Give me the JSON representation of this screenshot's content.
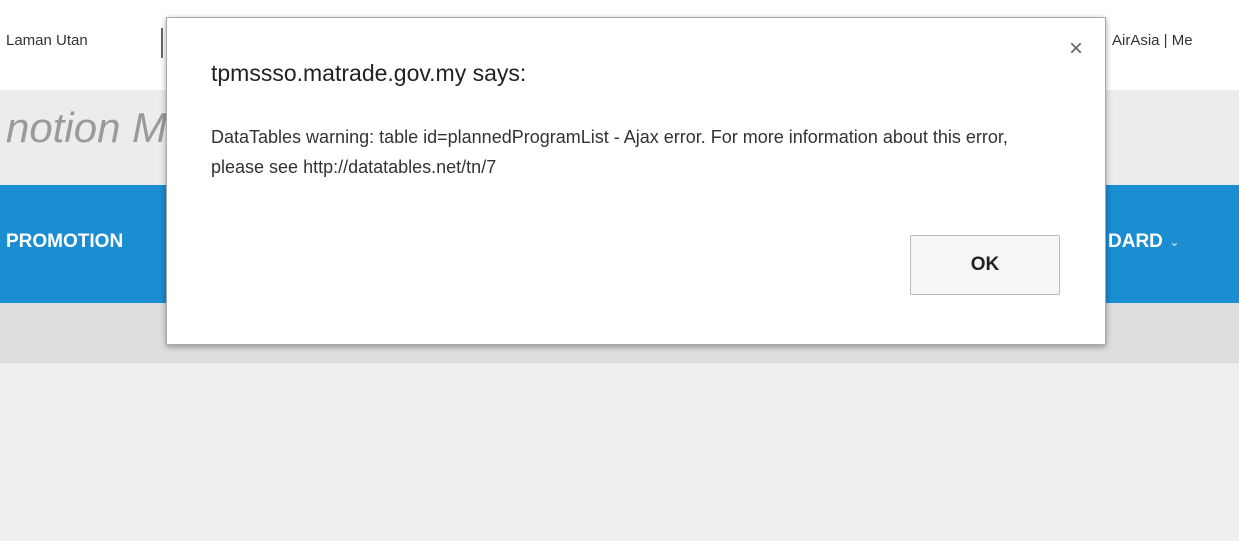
{
  "bookmarks": {
    "left_label": "Laman Utan",
    "right_label": "AirAsia | Me"
  },
  "site": {
    "title_fragment": "notion M"
  },
  "nav": {
    "left_item": "PROMOTION",
    "right_item": "DARD",
    "chevron": "⌄"
  },
  "dialog": {
    "title": "tpmssso.matrade.gov.my says:",
    "message": "DataTables warning: table id=plannedProgramList - Ajax error. For more information about this error, please see http://datatables.net/tn/7",
    "close_glyph": "×",
    "ok_label": "OK"
  }
}
